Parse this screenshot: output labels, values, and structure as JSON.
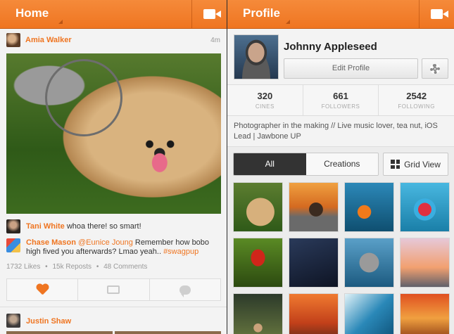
{
  "feed": {
    "title": "Home",
    "post": {
      "author": "Amia Walker",
      "time": "4m",
      "comments": [
        {
          "author": "Tani White",
          "text": " whoa there! so smart!"
        },
        {
          "author": "Chase Mason",
          "mention": "@Eunice Joung",
          "text": " Remember how bobo high fived you afterwards? Lmao yeah.. ",
          "hashtag": "#swagpup"
        }
      ],
      "likes": "1732 Likes",
      "reposts": "15k Reposts",
      "comment_count": "48 Comments",
      "separator": "•"
    },
    "next_post_author": "Justin Shaw"
  },
  "profile": {
    "title": "Profile",
    "name": "Johnny Appleseed",
    "edit_label": "Edit Profile",
    "stats": [
      {
        "value": "320",
        "label": "CINES"
      },
      {
        "value": "661",
        "label": "FOLLOWERS"
      },
      {
        "value": "2542",
        "label": "FOLLOWING"
      }
    ],
    "bio": "Photographer in the making // Live music lover, tea nut, iOS Lead | Jawbone UP",
    "tabs": [
      "All",
      "Creations"
    ],
    "grid_view_label": "Grid View"
  },
  "colors": {
    "accent": "#ef7521",
    "topbar": "#f58a3a"
  }
}
